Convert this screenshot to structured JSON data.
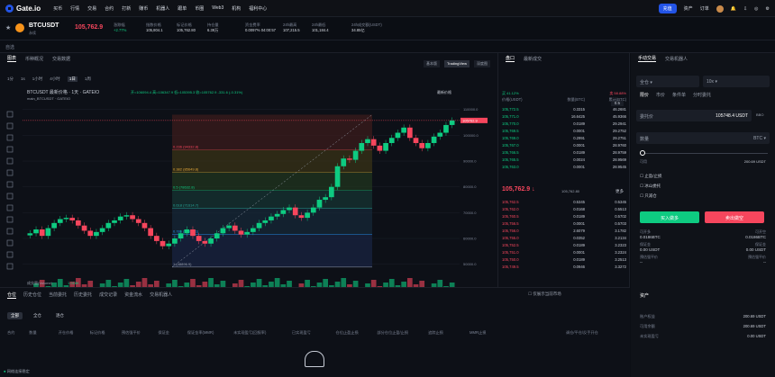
{
  "nav": {
    "brand": "Gate.io",
    "items": [
      "买币",
      "行情",
      "交易",
      "合约",
      "打新",
      "赚币",
      "机器人",
      "跟单",
      "币圈",
      "Web3",
      "机构",
      "福利中心"
    ],
    "login": "充值",
    "right": [
      "资产",
      "订单"
    ]
  },
  "ticker": {
    "pair": "BTCUSDT",
    "subtitle": "永续",
    "price": "105,762.9",
    "stats": [
      {
        "label": "涨跌幅",
        "value": "+2.77%"
      },
      {
        "label": "指数价格",
        "value": "105,804.1"
      },
      {
        "label": "标记价格",
        "value": "105,762.80"
      },
      {
        "label": "持仓量",
        "value": "6.39万"
      },
      {
        "label": "资金费率",
        "value": "0.0097% 04:00:57"
      },
      {
        "label": "24h最高",
        "value": "107,215.5"
      },
      {
        "label": "24h最低",
        "value": "101,184.4"
      },
      {
        "label": "24h成交额(USDT)",
        "value": "34.85亿"
      }
    ],
    "colors": {
      "up": "#0ecb81",
      "down": "#f6465d",
      "accent": "#2354e6"
    }
  },
  "subbar": {
    "label": "自选"
  },
  "chart_tabs": [
    "图表",
    "币种概况",
    "交易数据"
  ],
  "chart_toolbar": {
    "intervals": [
      "1分",
      "1s",
      "1小时",
      "4小时",
      "1日",
      "1周"
    ],
    "views": [
      "基本版",
      "TradingView",
      "深度图"
    ],
    "preset": "最新价格"
  },
  "chart_title": "BTCUSDT 最新价格 · 1天 · GATEIO",
  "ohlc": "开=106094.4 高=106347.9 低=105395.3 收=105762.9 -331.6 (-0.31%)",
  "indicator": "main_BTCUSDT · GATEIO",
  "chart_data": {
    "type": "candlestick",
    "title": "BTCUSDT 最新价格 · 1天 · GATEIO",
    "xlabel": "",
    "ylabel": "",
    "x_ticks": [
      "5月",
      "7月",
      "8月",
      "9月",
      "10月",
      "11月",
      "12月",
      "2025",
      "2月"
    ],
    "y_ticks": [
      "110000.0",
      "100000.0",
      "90000.0",
      "80000.0",
      "70000.0",
      "60000.0",
      "50000.0"
    ],
    "ylim": [
      45000,
      112000
    ],
    "closes": [
      62000,
      63500,
      61000,
      64000,
      66000,
      67500,
      68000,
      67000,
      65000,
      63000,
      61000,
      62500,
      64000,
      66000,
      67000,
      68500,
      69000,
      67500,
      66000,
      64000,
      61000,
      59000,
      57000,
      58000,
      60000,
      62000,
      63500,
      61000,
      59000,
      58000,
      60000,
      62000,
      64000,
      65000,
      63000,
      61500,
      62500,
      64000,
      66000,
      67000,
      68500,
      69500,
      71000,
      72000,
      69000,
      68000,
      70000,
      72000,
      75000,
      76000,
      80000,
      88000,
      91000,
      90500,
      94000,
      97000,
      98500,
      96000,
      94000,
      97000,
      99000,
      101000,
      103000,
      99000,
      97000,
      95000,
      97000,
      99500,
      101000,
      104000,
      105762
    ],
    "fib_levels": [
      {
        "label": "0.236 (94332.8)",
        "value": 94332.8
      },
      {
        "label": "0.382 (85649.8)",
        "value": 85649.8
      },
      {
        "label": "0.5 (78632.8)",
        "value": 78632.8
      },
      {
        "label": "0.618 (71614.7)",
        "value": 71614.7
      },
      {
        "label": "0.786 (61626.1)",
        "value": 61626.1
      },
      {
        "label": "1 (48896.9)",
        "value": 48896.9
      }
    ],
    "volume_label": "成交量(Volume)",
    "volume_value": "1.018K",
    "last_price_label": "105762.9",
    "grid": true
  },
  "indicators_row": [
    "MA",
    "EMA",
    "Volume",
    "MACD",
    "KDJ",
    "BOLL",
    "TD Sequential",
    "RSI-1",
    "SAR",
    "TRIX",
    "PO",
    "PC",
    "PVT",
    "CC",
    "KO",
    "NVI",
    "ASI",
    "EMV",
    "Momentum",
    "AB",
    "HV",
    "Ratio",
    "CCI",
    "Balance",
    "Williams",
    "BBW",
    "ADI",
    "DMI",
    "VOL",
    "AO",
    "ROC"
  ],
  "orderbook": {
    "tabs": [
      "盘口",
      "最新成交"
    ],
    "precision": "0.5",
    "header": [
      "价格(USDT)",
      "数量(BTC)",
      "累计(BTC)"
    ],
    "ratio_buy": "买 41.12%",
    "ratio_sell": "卖 58.88%",
    "asks": [
      [
        "105,772.5",
        "0.3315",
        "46.2681"
      ],
      [
        "105,771.0",
        "16.6425",
        "45.9366"
      ],
      [
        "105,770.0",
        "0.0189",
        "29.2941"
      ],
      [
        "105,769.5",
        "0.0001",
        "29.2752"
      ],
      [
        "105,769.0",
        "0.2991",
        "29.2751"
      ],
      [
        "105,767.0",
        "0.0001",
        "28.9760"
      ],
      [
        "105,766.5",
        "0.0189",
        "28.9759"
      ],
      [
        "105,765.5",
        "0.0024",
        "28.9569"
      ],
      [
        "105,763.0",
        "0.0001",
        "28.9545"
      ]
    ],
    "mid_price": "105,762.9",
    "mid_mark": "105,762.80",
    "more": "更多",
    "bids": [
      [
        "105,762.5",
        "0.5345",
        "0.5345"
      ],
      [
        "105,762.0",
        "0.0168",
        "0.5513"
      ],
      [
        "105,760.5",
        "0.0189",
        "0.5702"
      ],
      [
        "105,756.5",
        "0.0001",
        "0.5703"
      ],
      [
        "105,756.0",
        "2.6079",
        "3.1782"
      ],
      [
        "105,755.0",
        "0.0352",
        "3.2134"
      ],
      [
        "105,752.5",
        "0.0189",
        "3.2323"
      ],
      [
        "105,751.0",
        "0.0001",
        "3.2324"
      ],
      [
        "105,750.0",
        "0.0189",
        "3.2513"
      ],
      [
        "105,749.5",
        "0.0946",
        "3.3272"
      ]
    ]
  },
  "trade": {
    "tabs": [
      "手动交易",
      "交易机器人"
    ],
    "mode": "全仓",
    "leverage": "10x",
    "order_types": [
      "限价",
      "市价",
      "条件单",
      "分时委托"
    ],
    "price_label": "委托价",
    "price_value": "105748.4 USDT",
    "bbo": "BBO",
    "qty_label": "数量",
    "qty_unit": "BTC",
    "available_label": "可用",
    "available_value": "200.69 USDT",
    "checks": [
      "止盈/止损",
      "冰山委托",
      "只减仓"
    ],
    "buy_label": "买入做多",
    "sell_label": "卖出做空",
    "cost_rows": [
      {
        "label": "可开多",
        "value": "0.0186BTC"
      },
      {
        "label": "保证金",
        "value": "0.00 USDT"
      },
      {
        "label": "预估强平价",
        "value": "--"
      }
    ],
    "cost_rows_right": [
      {
        "label": "可开空",
        "value": "0.0186BTC"
      },
      {
        "label": "保证金",
        "value": "0.00 USDT"
      },
      {
        "label": "预估强平价",
        "value": "--"
      }
    ],
    "assets_title": "资产",
    "assets": [
      {
        "label": "账户权益",
        "value": "200.69 USDT"
      },
      {
        "label": "可用余额",
        "value": "200.69 USDT"
      },
      {
        "label": "未实现盈亏",
        "value": "0.00 USDT"
      }
    ]
  },
  "positions": {
    "tabs": [
      "仓位",
      "历史仓位",
      "当前委托",
      "历史委托",
      "成交记录",
      "资金流水",
      "交易机器人"
    ],
    "checkbox": "仅展示当前市场",
    "filters": [
      "全部",
      "全仓",
      "逐仓"
    ],
    "columns": [
      "合约",
      "数量",
      "开仓价格",
      "标记价格",
      "预估强平价",
      "保证金",
      "保证金率(MMR)",
      "未实现盈亏(回报率)",
      "已实现盈亏",
      "仓位止盈止损",
      "部分仓位止盈/止损",
      "追踪止损",
      "MMR止损",
      "调仓/平仓/反手开仓"
    ],
    "status": "网络连接稳定"
  }
}
